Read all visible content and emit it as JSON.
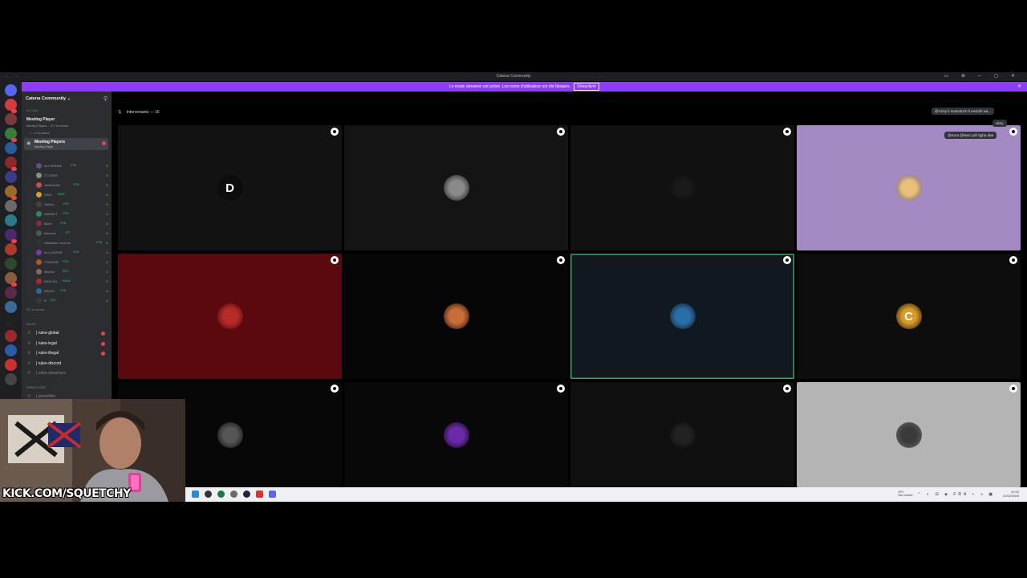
{
  "window": {
    "title": "Catena Community",
    "nav_arrows": "← →",
    "controls": "▭ ⊕ ─ ▢ ✕"
  },
  "banner": {
    "text": "Le mode streamer est activé. Les noms d'utilisateur ont été bloqués.",
    "button_label": "Désactiver",
    "close": "✕"
  },
  "sidebar": {
    "guild_name": "Catena Community ⌄",
    "live_label": "En Direct",
    "voice_title": "Meeting Player",
    "voice_sub": "Meeting Players ... 377 en écoute",
    "voice_sub2": "L... et 15 autres",
    "active_channel": {
      "name": "Meeting Players",
      "sub": "Meeting Player"
    },
    "members": [
      {
        "name": "ALI HOKMA",
        "tag": "CTN"
      },
      {
        "name": "ΣΞΞΩRΘ",
        "tag": ""
      },
      {
        "name": "JackDaniel",
        "tag": "CTN"
      },
      {
        "name": "KING",
        "tag": "KING"
      },
      {
        "name": "Sahlox",
        "tag": "CTN"
      },
      {
        "name": "ANNAUT",
        "tag": "CTN"
      },
      {
        "name": "Bjorn",
        "tag": "CTN"
      },
      {
        "name": "Mercury",
        "tag": "377"
      },
      {
        "name": "Utilisateur inconnu",
        "tag": "CTN"
      },
      {
        "name": "Mr.LUCIFER",
        "tag": "CTN"
      },
      {
        "name": "CONNOR",
        "tag": "CTN"
      },
      {
        "name": "Mechin",
        "tag": "EPS"
      },
      {
        "name": "KNAYDA",
        "tag": "RAJA"
      },
      {
        "name": "BINGO",
        "tag": "CTN"
      },
      {
        "name": "R",
        "tag": "CTN"
      }
    ],
    "listeners": "377 en écoute",
    "rules_category": "RULES",
    "text_channels": [
      {
        "name": "| rules-global",
        "unread": true
      },
      {
        "name": "| rules-legal",
        "unread": true
      },
      {
        "name": "| rules-illegal",
        "unread": true
      },
      {
        "name": "| rules-discord",
        "unread": false
      },
      {
        "name": "| rules-streamers",
        "unread": false
      }
    ],
    "prime_category": "PRIME FILTER",
    "prime_channel": "| primefilter"
  },
  "stage": {
    "speakers_label": "Intervenants — 16",
    "tiles": [
      {
        "bg": "#121212",
        "avatar_bg": "#0c0c0c",
        "avatar_text": "D",
        "highlight": false
      },
      {
        "bg": "#141414",
        "avatar_bg": "#8a8a8a",
        "avatar_text": "",
        "highlight": false
      },
      {
        "bg": "#111111",
        "avatar_bg": "#1a1a1a",
        "avatar_text": "",
        "highlight": false
      },
      {
        "bg": "#a48ac2",
        "avatar_bg": "#e8c07a",
        "avatar_text": "",
        "highlight": false
      },
      {
        "bg": "#5a0a0e",
        "avatar_bg": "#b82a28",
        "avatar_text": "",
        "highlight": false
      },
      {
        "bg": "#060606",
        "avatar_bg": "#c86c3a",
        "avatar_text": "",
        "highlight": false
      },
      {
        "bg": "#101820",
        "avatar_bg": "#2a6ea8",
        "avatar_text": "",
        "highlight": true
      },
      {
        "bg": "#0d0d0d",
        "avatar_bg": "#d89a2a",
        "avatar_text": "C",
        "highlight": false
      },
      {
        "bg": "#070707",
        "avatar_bg": "#555555",
        "avatar_text": "",
        "highlight": false
      },
      {
        "bg": "#080808",
        "avatar_bg": "#6a2aa8",
        "avatar_text": "",
        "highlight": false
      },
      {
        "bg": "#0f0f0f",
        "avatar_bg": "#222222",
        "avatar_text": "",
        "highlight": false
      },
      {
        "bg": "#b4b4b4",
        "avatar_bg": "#3a3a3a",
        "avatar_text": "",
        "highlight": false
      }
    ],
    "chat": [
      {
        "text": "@Army li ma3ndoch li envi/sh wa..."
      },
      {
        "text": "okey"
      },
      {
        "text": "@Kura @Haro jofr bgha idwi"
      }
    ],
    "option_icon": "more-options-icon"
  },
  "taskbar": {
    "weather_line1": "19°C",
    "weather_line2": "Ciel couvert",
    "tray_icons": "⌃ ◐ ⊟ ◈ FRA ⌁ ◑ ▣",
    "time": "22:02",
    "date": "21/02/2026"
  },
  "webcam": {
    "label": "KICK.COM/SQUETCHY"
  },
  "colors": {
    "banner": "#8c3df5",
    "sidebar": "#2b2d31",
    "rail": "#1e1f22",
    "online": "#23a55a",
    "unread": "#f23f43",
    "speaking": "#3ba55d"
  }
}
